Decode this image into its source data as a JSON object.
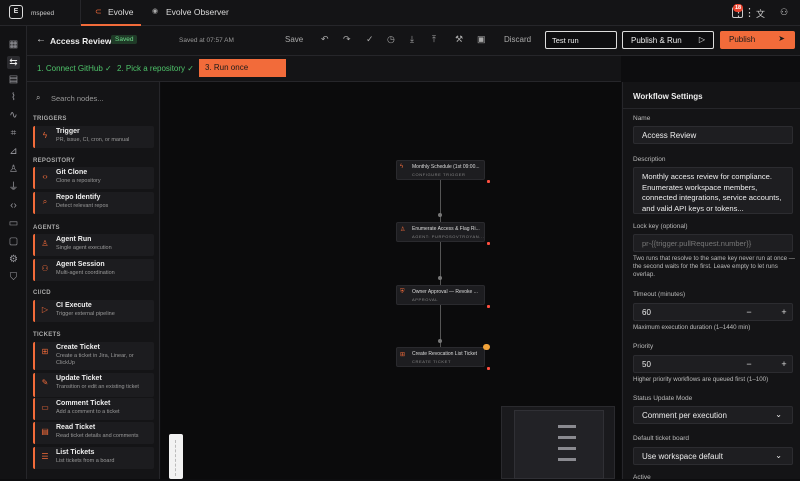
{
  "topbar": {
    "brand": "mspeed",
    "tabs": [
      {
        "label": "Evolve",
        "active": true
      },
      {
        "label": "Evolve Observer",
        "active": false
      }
    ],
    "notification_count": "18"
  },
  "subbar": {
    "title": "Access Review",
    "status_badge": "Saved",
    "saved_at": "Saved at 07:57 AM",
    "save_label": "Save",
    "discard_label": "Discard",
    "test_run_value": "Test run",
    "publish_run_label": "Publish & Run",
    "publish_label": "Publish"
  },
  "steps": [
    {
      "label": "1. Connect GitHub ✓"
    },
    {
      "label": "2. Pick a repository ✓"
    },
    {
      "label": "3. Run once"
    }
  ],
  "palette": {
    "search_placeholder": "Search nodes...",
    "sections": [
      {
        "title": "TRIGGERS",
        "items": [
          {
            "title": "Trigger",
            "desc": "PR, issue, CI, cron, or manual",
            "icon": "lightning-icon"
          }
        ]
      },
      {
        "title": "REPOSITORY",
        "items": [
          {
            "title": "Git Clone",
            "desc": "Clone a repository",
            "icon": "code-icon"
          },
          {
            "title": "Repo Identify",
            "desc": "Detect relevant repos",
            "icon": "search-icon"
          }
        ]
      },
      {
        "title": "AGENTS",
        "items": [
          {
            "title": "Agent Run",
            "desc": "Single agent execution",
            "icon": "agent-icon"
          },
          {
            "title": "Agent Session",
            "desc": "Multi-agent coordination",
            "icon": "agents-icon"
          }
        ]
      },
      {
        "title": "CI/CD",
        "items": [
          {
            "title": "CI Execute",
            "desc": "Trigger external pipeline",
            "icon": "play-icon"
          }
        ]
      },
      {
        "title": "TICKETS",
        "items": [
          {
            "title": "Create Ticket",
            "desc": "Create a ticket in Jira, Linear, or ClickUp",
            "icon": "ticket-plus-icon"
          },
          {
            "title": "Update Ticket",
            "desc": "Transition or edit an existing ticket",
            "icon": "ticket-edit-icon"
          },
          {
            "title": "Comment Ticket",
            "desc": "Add a comment to a ticket",
            "icon": "comment-icon"
          },
          {
            "title": "Read Ticket",
            "desc": "Read ticket details and comments",
            "icon": "ticket-icon"
          },
          {
            "title": "List Tickets",
            "desc": "List tickets from a board",
            "icon": "list-icon"
          }
        ]
      }
    ]
  },
  "canvas": {
    "nodes": [
      {
        "title": "Monthly Schedule (1st 09:00...",
        "subtitle": "CONFIGURE TRIGGER",
        "icon": "lightning-icon"
      },
      {
        "title": "Enumerate Access & Flag Ri...",
        "subtitle": "AGENT: PURPOSOVTROYAN...",
        "icon": "agent-icon"
      },
      {
        "title": "Owner Approval — Revoke ...",
        "subtitle": "APPROVAL",
        "icon": "approval-icon"
      },
      {
        "title": "Create Revocation List Ticket",
        "subtitle": "CREATE TICKET",
        "icon": "ticket-plus-icon"
      }
    ]
  },
  "settings": {
    "header": "Workflow Settings",
    "name_label": "Name",
    "name_value": "Access Review",
    "description_label": "Description",
    "description_value": "Monthly access review for compliance. Enumerates workspace members, connected integrations, service accounts, and valid API keys or tokens...",
    "lock_key_label": "Lock key (optional)",
    "lock_key_placeholder": "pr-{{trigger.pullRequest.number}}",
    "lock_key_help": "Two runs that resolve to the same key never run at once — the second waits for the first. Leave empty to let runs overlap.",
    "timeout_label": "Timeout (minutes)",
    "timeout_value": "60",
    "timeout_help": "Maximum execution duration (1–1440 min)",
    "priority_label": "Priority",
    "priority_value": "50",
    "priority_help": "Higher priority workflows are queued first (1–100)",
    "status_mode_label": "Status Update Mode",
    "status_mode_value": "Comment per execution",
    "ticket_board_label": "Default ticket board",
    "ticket_board_value": "Use workspace default",
    "active_label": "Active"
  },
  "colors": {
    "accent": "#f26b3a",
    "background": "#0d0d0f",
    "panel": "#141416",
    "success": "#4ec36a"
  }
}
